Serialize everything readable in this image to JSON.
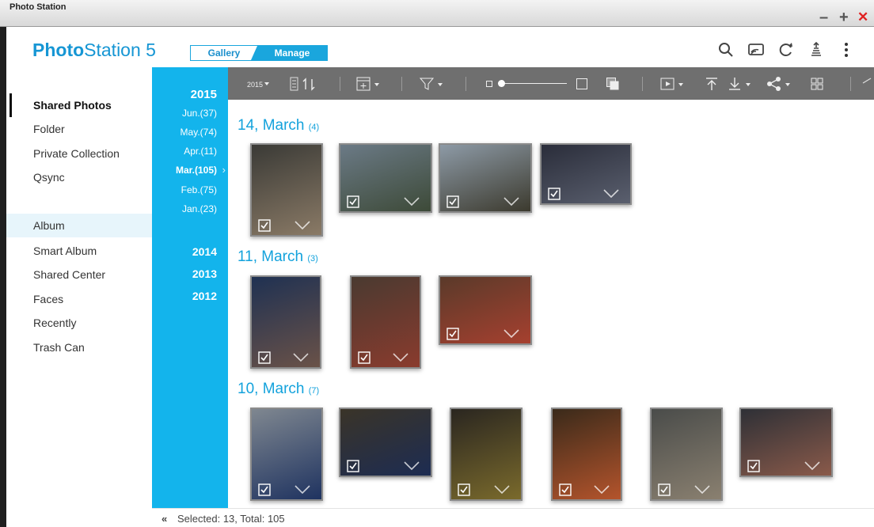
{
  "window": {
    "title": "Photo Station",
    "minimize": "–",
    "maximize": "+",
    "close": "✕"
  },
  "header": {
    "logo_bold": "Photo",
    "logo_rest": "Station 5",
    "gallery_label": "Gallery",
    "manage_label": "Manage",
    "icons": [
      "search-icon",
      "cast-icon",
      "refresh-icon",
      "background-task-icon",
      "more-icon"
    ]
  },
  "sidebar": {
    "items": [
      {
        "label": "Shared Photos",
        "bold": true
      },
      {
        "label": "Folder"
      },
      {
        "label": "Private Collection"
      },
      {
        "label": "Qsync"
      },
      {
        "label": "Album",
        "selected": true
      },
      {
        "label": "Smart Album"
      },
      {
        "label": "Shared Center"
      },
      {
        "label": "Faces"
      },
      {
        "label": "Recently"
      },
      {
        "label": "Trash Can"
      }
    ]
  },
  "timeline": {
    "current_year": "2015",
    "months": [
      {
        "label": "Jun.(37)"
      },
      {
        "label": "May.(74)"
      },
      {
        "label": "Apr.(11)"
      },
      {
        "label": "Mar.(105)",
        "active": true
      },
      {
        "label": "Feb.(75)"
      },
      {
        "label": "Jan.(23)"
      }
    ],
    "other_years": [
      "2014",
      "2013",
      "2012"
    ]
  },
  "toolbar": {
    "icons": [
      "timeline-view-icon",
      "sort-icon",
      "new-album-icon",
      "filter-icon",
      "zoom-slider",
      "large-thumbnail-icon",
      "multi-select-icon",
      "slideshow-icon",
      "upload-icon",
      "download-icon",
      "share-icon",
      "grid-view-icon"
    ]
  },
  "groups": [
    {
      "date": "14, March",
      "count": "(4)",
      "photos": 4
    },
    {
      "date": "11, March",
      "count": "(3)",
      "photos": 3
    },
    {
      "date": "10, March",
      "count": "(7)",
      "photos": 6
    }
  ],
  "status": {
    "collapse": "«",
    "text": "Selected: 13, Total: 105"
  },
  "colors": {
    "accent": "#13b4ec",
    "toolbar": "#6f6f6f",
    "date_heading": "#13a2dc",
    "close": "#e02020"
  }
}
